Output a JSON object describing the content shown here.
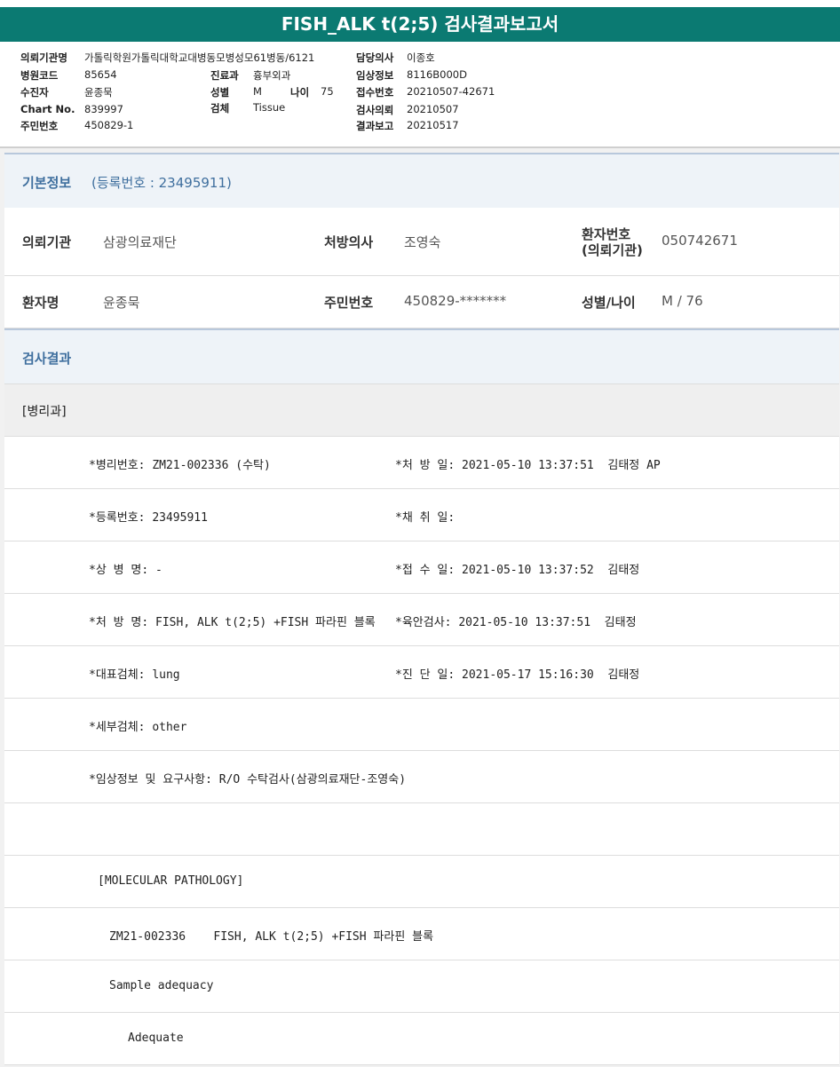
{
  "report": {
    "title": "FISH_ALK t(2;5) 검사결과보고서"
  },
  "header": {
    "left": [
      {
        "label": "의뢰기관명",
        "value": "가톨릭학원가톨릭대학교대병동모병성모61병동/6121"
      },
      {
        "label": "병원코드",
        "value": "85654"
      },
      {
        "label": "수진자",
        "value": "윤종묵"
      },
      {
        "label": "Chart No.",
        "value": "839997"
      },
      {
        "label": "주민번호",
        "value": "450829-1"
      }
    ],
    "mid": [
      {
        "label": "진료과",
        "value": "흉부외과"
      },
      {
        "label": "성별",
        "value": "M"
      },
      {
        "label": "검체",
        "value": "Tissue"
      }
    ],
    "age": {
      "label": "나이",
      "value": "75"
    },
    "right": [
      {
        "label": "담당의사",
        "value": "이종호"
      },
      {
        "label": "임상정보",
        "value": "8116B000D"
      },
      {
        "label": "접수번호",
        "value": "20210507-42671"
      },
      {
        "label": "검사의뢰",
        "value": "20210507"
      },
      {
        "label": "결과보고",
        "value": "20210517"
      }
    ]
  },
  "basic": {
    "title": "기본정보",
    "subtitle": "(등록번호 : 23495911)",
    "row1": [
      {
        "label": "의뢰기관",
        "value": "삼광의료재단"
      },
      {
        "label": "처방의사",
        "value": "조영숙"
      },
      {
        "label": "환자번호",
        "label2": "(의뢰기관)",
        "value": "050742671"
      }
    ],
    "row2": [
      {
        "label": "환자명",
        "value": "윤종묵"
      },
      {
        "label": "주민번호",
        "value": "450829-*******"
      },
      {
        "label": "성별/나이",
        "value": "M / 76"
      }
    ]
  },
  "result": {
    "title": "검사결과",
    "department": "[병리과]",
    "rows": [
      {
        "c1": "*병리번호: ZM21-002336 (수탁)",
        "c2": "*처 방 일: 2021-05-10 13:37:51  김태정 AP"
      },
      {
        "c1": "*등록번호: 23495911",
        "c2": "*채 취 일:"
      },
      {
        "c1": "*상 병 명: -",
        "c2": "*접 수 일: 2021-05-10 13:37:52  김태정"
      },
      {
        "c1": "*처 방 명: FISH, ALK t(2;5) +FISH 파라핀 블록",
        "c2": "*육안검사: 2021-05-10 13:37:51  김태정"
      },
      {
        "c1": "*대표검체: lung",
        "c2": "*진 단 일: 2021-05-17 15:16:30  김태정"
      },
      {
        "c1": "*세부검체: other",
        "c2": ""
      },
      {
        "c1": "*임상정보 및 요구사항: R/O 수탁검사(삼광의료재단-조영숙)",
        "c2": ""
      },
      {
        "c1": "",
        "c2": ""
      },
      {
        "c1": "[MOLECULAR PATHOLOGY]",
        "c2": ""
      },
      {
        "c1": "ZM21-002336    FISH, ALK t(2;5) +FISH 파라핀 블록",
        "c2": ""
      },
      {
        "c1": "Sample adequacy",
        "c2": ""
      },
      {
        "c1": "Adequate",
        "c2": ""
      }
    ]
  }
}
